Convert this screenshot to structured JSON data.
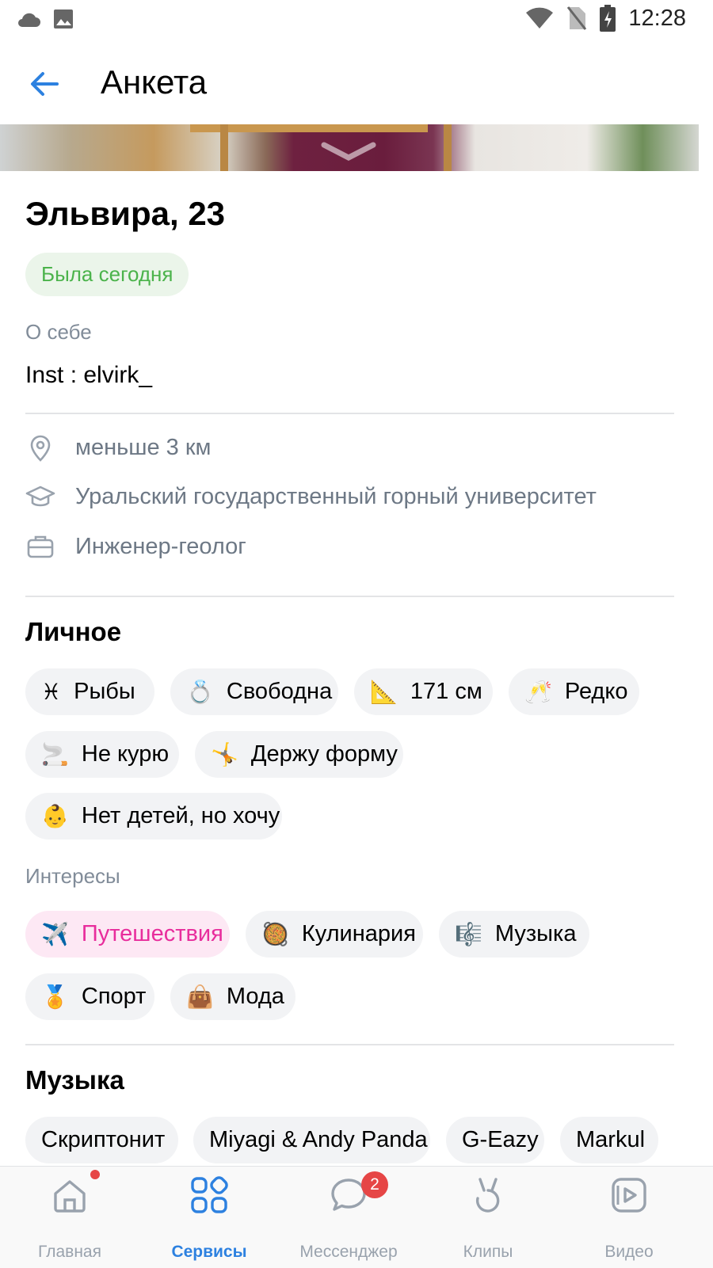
{
  "status_bar": {
    "time": "12:28"
  },
  "header": {
    "title": "Анкета"
  },
  "profile": {
    "name": "Эльвира, 23",
    "online_status": "Была сегодня",
    "about_label": "О себе",
    "about_text": "Inst : elvirk_",
    "distance": "меньше 3 км",
    "education": "Уральский государственный горный университет",
    "job": "Инженер-геолог"
  },
  "personal": {
    "title": "Личное",
    "chips": [
      {
        "emoji": "♓",
        "label": "Рыбы"
      },
      {
        "emoji": "💍",
        "label": "Свободна"
      },
      {
        "emoji": "📐",
        "label": "171 см"
      },
      {
        "emoji": "🥂",
        "label": "Редко"
      },
      {
        "emoji": "🚬",
        "label": "Не курю"
      },
      {
        "emoji": "🤸",
        "label": "Держу форму"
      },
      {
        "emoji": "👶",
        "label": "Нет детей, но хочу"
      }
    ]
  },
  "interests": {
    "title": "Интересы",
    "chips": [
      {
        "emoji": "✈️",
        "label": "Путешествия",
        "selected": true
      },
      {
        "emoji": "🥘",
        "label": "Кулинария"
      },
      {
        "emoji": "🎼",
        "label": "Музыка"
      },
      {
        "emoji": "🏅",
        "label": "Спорт"
      },
      {
        "emoji": "👜",
        "label": "Мода"
      }
    ]
  },
  "music": {
    "title": "Музыка",
    "chips": [
      "Скриптонит",
      "Miyagi & Andy Panda",
      "G-Eazy",
      "Markul"
    ]
  },
  "tabbar": {
    "tabs": [
      {
        "label": "Главная",
        "icon": "home-icon"
      },
      {
        "label": "Сервисы",
        "icon": "services-icon",
        "active": true
      },
      {
        "label": "Мессенджер",
        "icon": "messenger-icon",
        "badge": "2"
      },
      {
        "label": "Клипы",
        "icon": "clips-icon"
      },
      {
        "label": "Видео",
        "icon": "video-icon"
      }
    ]
  },
  "colors": {
    "accent": "#2d81e0",
    "online_green": "#4bb34b",
    "pink": "#e82d9c",
    "badge_red": "#e64646"
  }
}
